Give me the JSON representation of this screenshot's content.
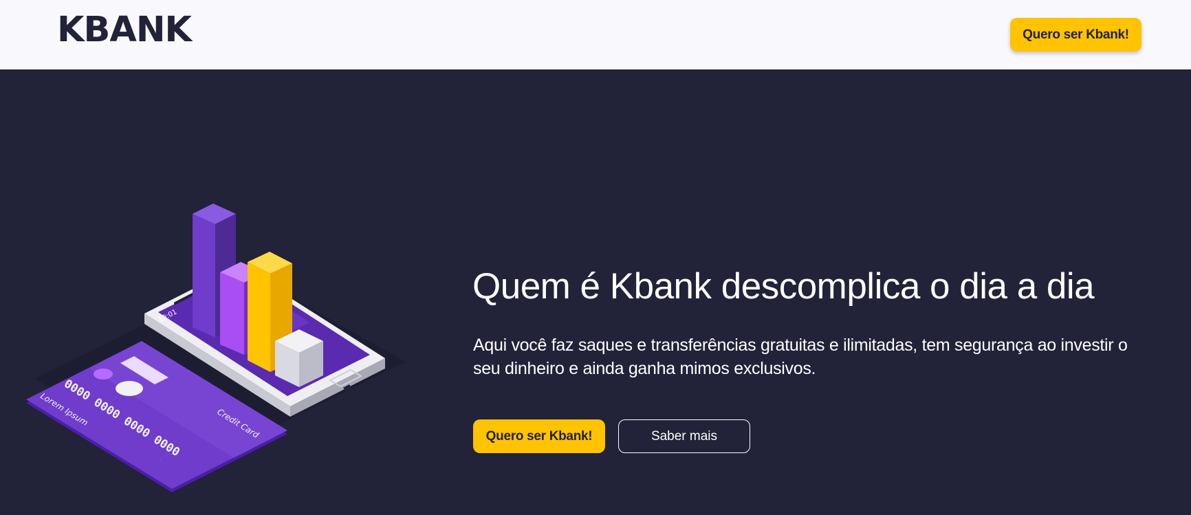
{
  "header": {
    "logo": "KBANK",
    "cta_label": "Quero ser Kbank!"
  },
  "hero": {
    "title": "Quem é Kbank descomplica o dia a dia",
    "description_line1": "Aqui você faz saques e transferências gratuitas e ilimitadas, tem segurança ao investir o",
    "description_line2": "seu dinheiro e ainda ganha mimos exclusivos.",
    "primary_cta": "Quero ser Kbank!",
    "secondary_cta": "Saber mais"
  },
  "illustration": {
    "card_number": "0000 0000 0000 0000",
    "card_holder": "Lorem Ipsum",
    "card_type": "Credit Card",
    "phone_time": "10:01"
  },
  "colors": {
    "background_dark": "#222239",
    "header_bg": "#f9f9fd",
    "accent_yellow": "#ffc300",
    "purple": "#6f3ccc",
    "text_light": "#ffffff"
  }
}
